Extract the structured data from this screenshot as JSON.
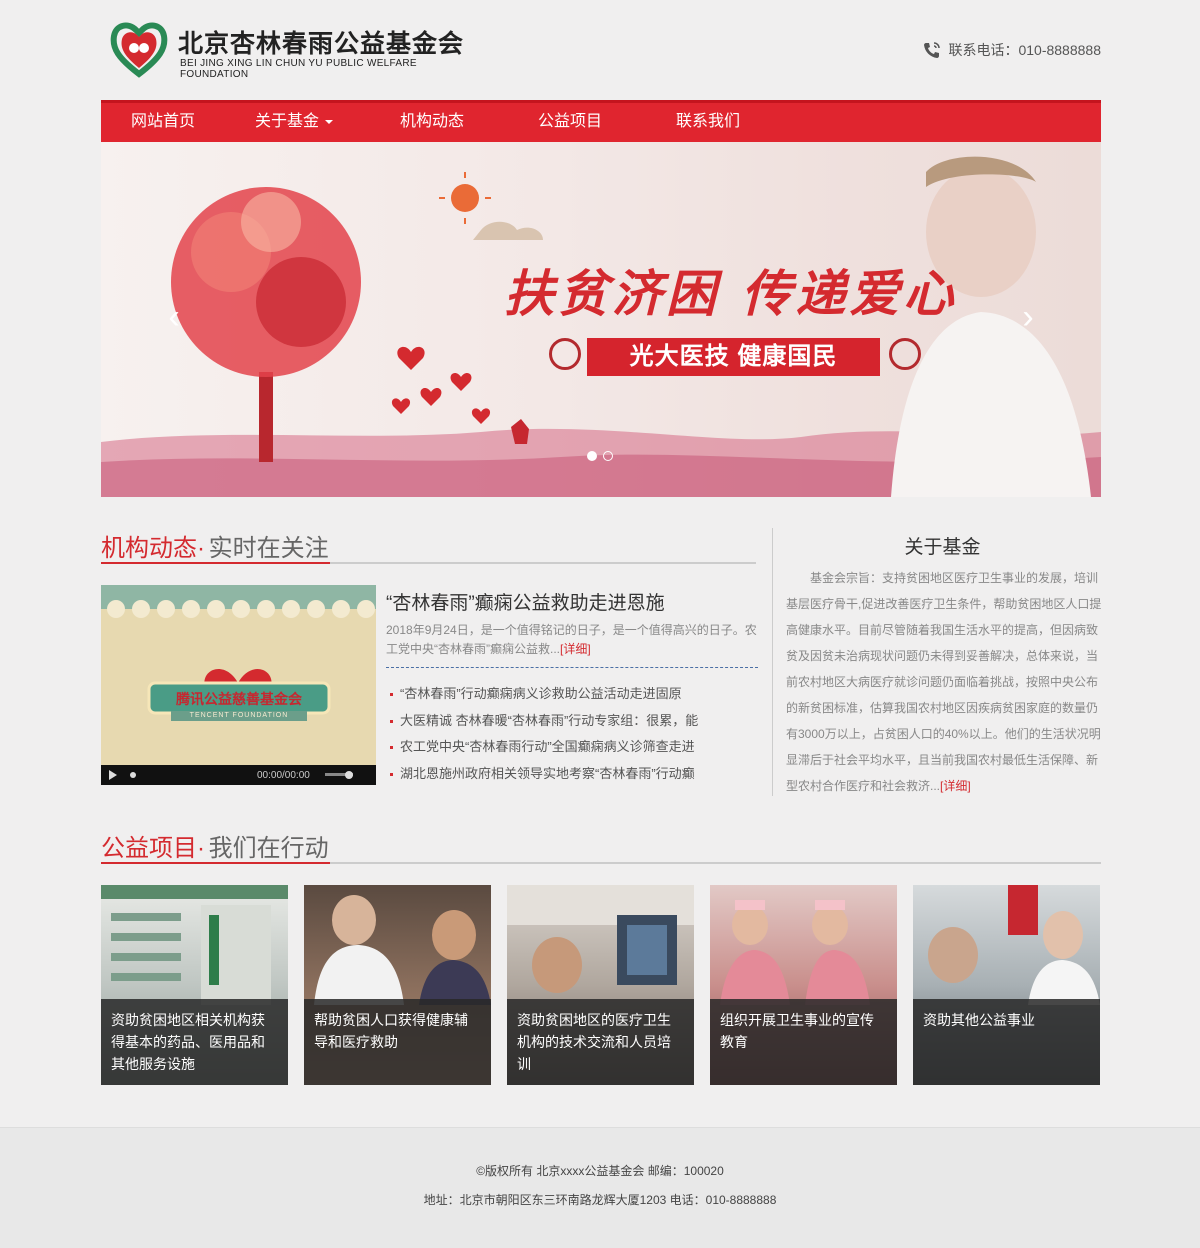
{
  "header": {
    "logo_cn": "北京杏林春雨公益基金会",
    "logo_en": "BEI JING XING LIN CHUN YU PUBLIC WELFARE FOUNDATION",
    "phone_label": "联系电话：010-8888888"
  },
  "nav": {
    "items": [
      {
        "label": "网站首页"
      },
      {
        "label": "关于基金"
      },
      {
        "label": "机构动态"
      },
      {
        "label": "公益项目"
      },
      {
        "label": "联系我们"
      }
    ]
  },
  "banner": {
    "slogan": "扶贫济困 传递爱心",
    "strip": "光大医技 健康国民",
    "prev": "‹",
    "next": "›"
  },
  "news_section": {
    "title_red": "机构动态·",
    "title_grey": "实时在关注",
    "video_badge": "腾讯公益慈善基金会",
    "video_badge_en": "TENCENT FOUNDATION",
    "video_time": "00:00/00:00",
    "featured_title": "“杏林春雨”癫痫公益救助走进恩施",
    "featured_summary": "2018年9月24日，是一个值得铭记的日子，是一个值得高兴的日子。农工党中央“杏林春雨”癫痫公益救...",
    "more_label": "[详细]",
    "items": [
      "“杏林春雨”行动癫痫病义诊救助公益活动走进固原",
      "大医精诚 杏林春暖“杏林春雨”行动专家组：很累，能",
      "农工党中央“杏林春雨行动”全国癫痫病义诊筛查走进",
      "湖北恩施州政府相关领导实地考察“杏林春雨”行动癫"
    ]
  },
  "about": {
    "title": "关于基金",
    "text": "基金会宗旨：支持贫困地区医疗卫生事业的发展，培训基层医疗骨干,促进改善医疗卫生条件，帮助贫困地区人口提高健康水平。目前尽管随着我国生活水平的提高，但因病致贫及因贫未治病现状问题仍未得到妥善解决，总体来说，当前农村地区大病医疗就诊问题仍面临着挑战，按照中央公布的新贫困标准，估算我国农村地区因疾病贫困家庭的数量仍有3000万以上，占贫困人口的40%以上。他们的生活状况明显滞后于社会平均水平，且当前我国农村最低生活保障、新型农村合作医疗和社会救济...",
    "more_label": "[详细]"
  },
  "projects_section": {
    "title_red": "公益项目·",
    "title_grey": "我们在行动",
    "items": [
      {
        "caption": "资助贫困地区相关机构获得基本的药品、医用品和其他服务设施"
      },
      {
        "caption": "帮助贫困人口获得健康辅导和医疗救助"
      },
      {
        "caption": "资助贫困地区的医疗卫生机构的技术交流和人员培训"
      },
      {
        "caption": "组织开展卫生事业的宣传教育"
      },
      {
        "caption": "资助其他公益事业"
      }
    ]
  },
  "footer": {
    "line1": "©版权所有 北京xxxx公益基金会    邮编：100020",
    "line2": "地址：北京市朝阳区东三环南路龙辉大厦1203 电话：010-8888888"
  }
}
